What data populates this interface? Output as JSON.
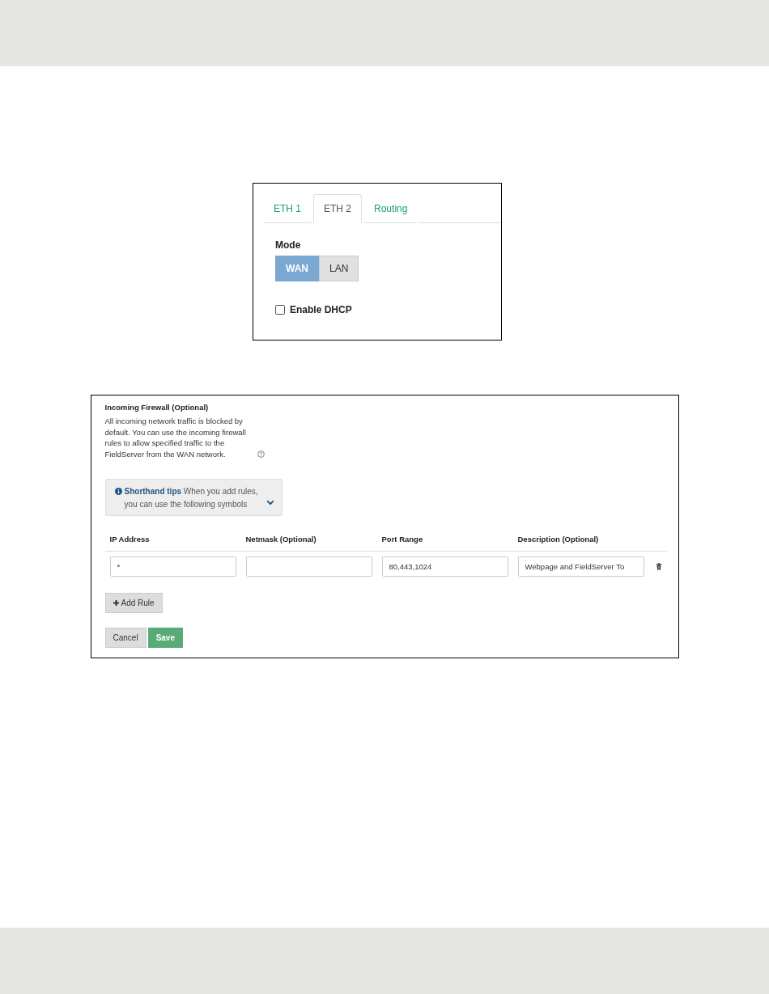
{
  "eth_panel": {
    "tabs": [
      {
        "label": "ETH 1",
        "selected": false
      },
      {
        "label": "ETH 2",
        "selected": true
      },
      {
        "label": "Routing",
        "selected": false
      }
    ],
    "mode": {
      "label": "Mode",
      "options": [
        {
          "label": "WAN",
          "selected": true
        },
        {
          "label": "LAN",
          "selected": false
        }
      ]
    },
    "enable_dhcp": {
      "label": "Enable DHCP",
      "checked": false
    }
  },
  "firewall_panel": {
    "title": "Incoming Firewall (Optional)",
    "description": "All incoming network traffic is blocked by default. You can use the incoming firewall rules to allow specified traffic to the FieldServer from the WAN network.",
    "tips": {
      "title": "Shorthand tips",
      "text": "When you add rules, you can use the following symbols",
      "expanded": false
    },
    "columns": [
      "IP Address",
      "Netmask (Optional)",
      "Port Range",
      "Description (Optional)"
    ],
    "rows": [
      {
        "cells": [
          "*",
          null,
          "80,443,1024",
          "Webpage and FieldServer To"
        ]
      }
    ],
    "add_button": "Add Rule",
    "buttons": [
      {
        "label": "Cancel",
        "kind": "secondary"
      },
      {
        "label": "Save",
        "kind": "primary"
      }
    ]
  }
}
